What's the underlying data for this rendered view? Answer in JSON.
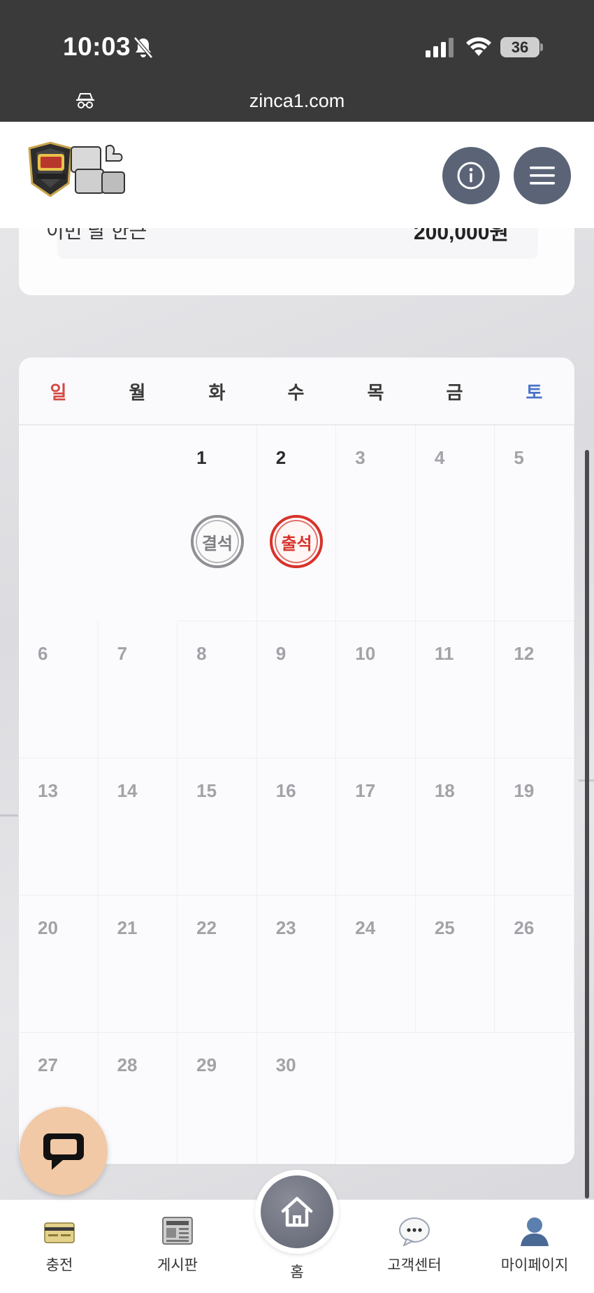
{
  "status_bar": {
    "time": "10:03",
    "battery": "36",
    "url": "zinca1.com"
  },
  "header": {
    "logo_icon": "casino-logo",
    "info_icon": "info-icon",
    "menu_icon": "hamburger-menu-icon"
  },
  "summary": {
    "label": "이번 달 한근",
    "value": "200,000원"
  },
  "calendar": {
    "weekdays": [
      "일",
      "월",
      "화",
      "수",
      "목",
      "금",
      "토"
    ],
    "weeks": [
      [
        "",
        "",
        "1",
        "2",
        "3",
        "4",
        "5"
      ],
      [
        "6",
        "7",
        "8",
        "9",
        "10",
        "11",
        "12"
      ],
      [
        "13",
        "14",
        "15",
        "16",
        "17",
        "18",
        "19"
      ],
      [
        "20",
        "21",
        "22",
        "23",
        "24",
        "25",
        "26"
      ],
      [
        "27",
        "28",
        "29",
        "30",
        "",
        "",
        ""
      ]
    ],
    "stamps": {
      "day1": "결석",
      "day2": "출석"
    },
    "colors": {
      "sunday": "#d34a45",
      "saturday": "#4a73c8",
      "present": "#d8322c",
      "absent": "#8f8f95"
    }
  },
  "bottom_nav": {
    "charge": "충전",
    "board": "게시판",
    "home": "홈",
    "support": "고객센터",
    "mypage": "마이페이지"
  }
}
